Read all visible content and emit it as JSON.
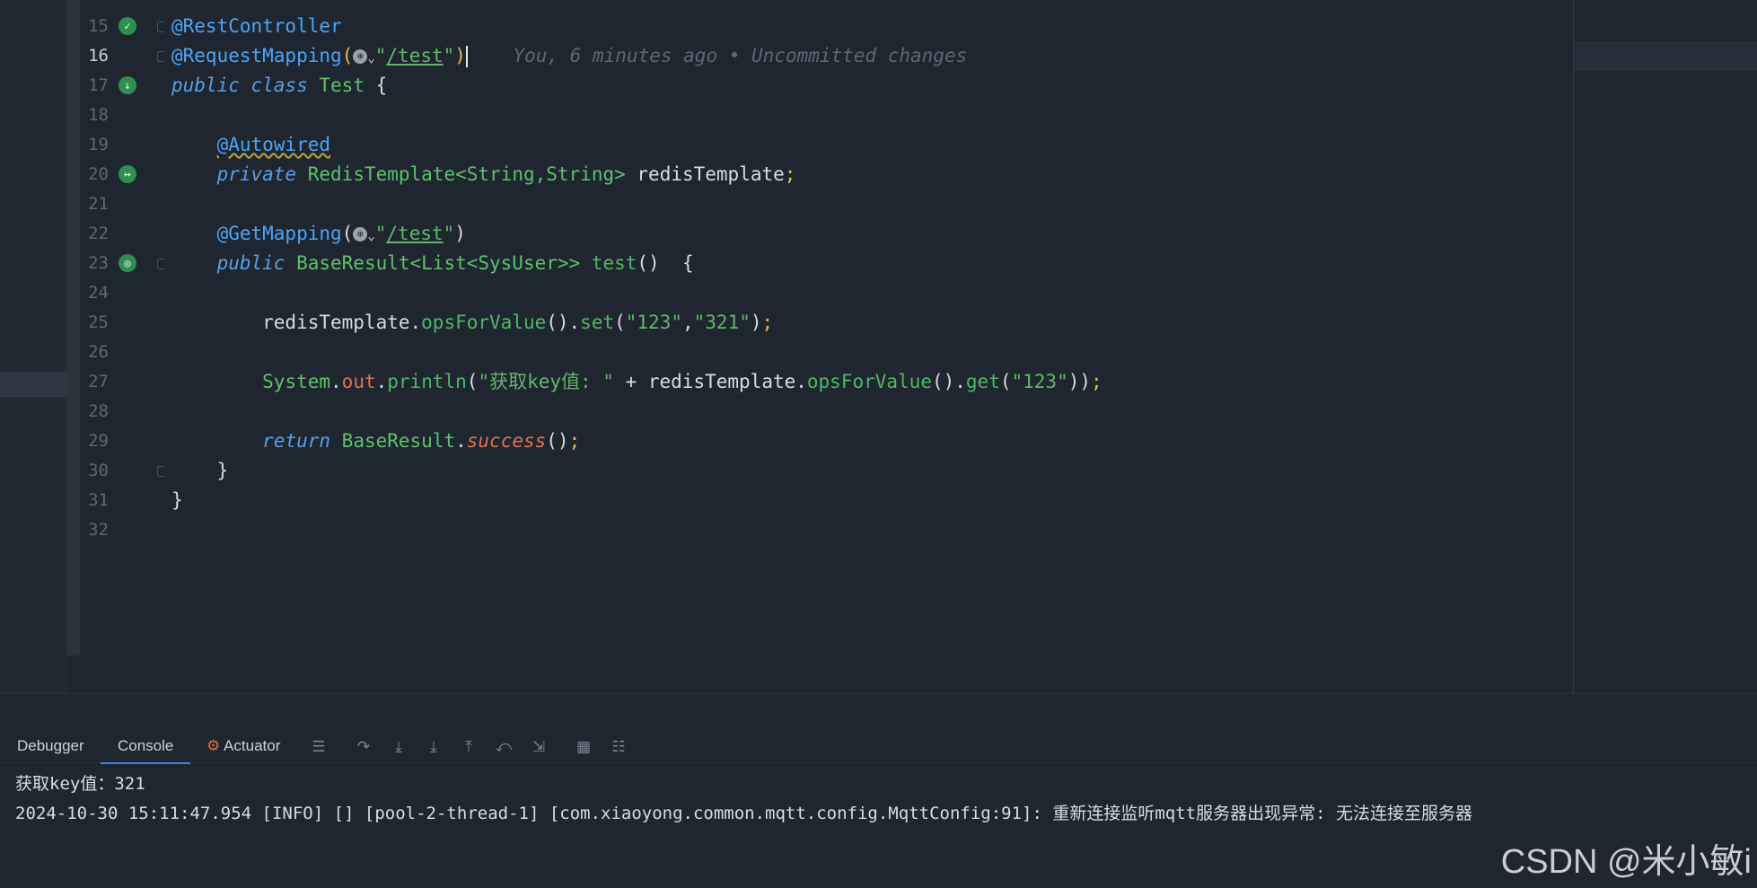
{
  "editor": {
    "lines": [
      {
        "num": "15",
        "tokens": [
          {
            "c": "ann",
            "t": "@RestController"
          }
        ]
      },
      {
        "num": "16",
        "current": true,
        "tokens": [
          {
            "c": "ann",
            "t": "@RequestMapping"
          },
          {
            "c": "sep",
            "t": "("
          },
          {
            "c": "str",
            "t": "\""
          },
          {
            "c": "link",
            "t": "/test"
          },
          {
            "c": "str",
            "t": "\""
          },
          {
            "c": "sep",
            "t": ")"
          }
        ],
        "hint": "You, 6 minutes ago • Uncommitted changes"
      },
      {
        "num": "17",
        "tokens": [
          {
            "c": "kw",
            "t": "public"
          },
          {
            "c": "plain",
            "t": " "
          },
          {
            "c": "kw",
            "t": "class"
          },
          {
            "c": "plain",
            "t": " "
          },
          {
            "c": "type",
            "t": "Test"
          },
          {
            "c": "plain",
            "t": " {"
          }
        ]
      },
      {
        "num": "18",
        "tokens": []
      },
      {
        "num": "19",
        "tokens": [
          {
            "c": "plain",
            "t": "    "
          },
          {
            "c": "ann wavy",
            "t": "@Autowired"
          }
        ]
      },
      {
        "num": "20",
        "tokens": [
          {
            "c": "plain",
            "t": "    "
          },
          {
            "c": "kw",
            "t": "private"
          },
          {
            "c": "plain",
            "t": " "
          },
          {
            "c": "type",
            "t": "RedisTemplate<String,String>"
          },
          {
            "c": "plain",
            "t": " redisTemplate"
          },
          {
            "c": "sep",
            "t": ";"
          }
        ]
      },
      {
        "num": "21",
        "tokens": []
      },
      {
        "num": "22",
        "tokens": [
          {
            "c": "plain",
            "t": "    "
          },
          {
            "c": "ann",
            "t": "@GetMapping"
          },
          {
            "c": "punct",
            "t": "("
          },
          {
            "c": "str",
            "t": "\""
          },
          {
            "c": "link",
            "t": "/test"
          },
          {
            "c": "str",
            "t": "\""
          },
          {
            "c": "punct",
            "t": ")"
          }
        ]
      },
      {
        "num": "23",
        "tokens": [
          {
            "c": "plain",
            "t": "    "
          },
          {
            "c": "kw",
            "t": "public"
          },
          {
            "c": "plain",
            "t": " "
          },
          {
            "c": "type",
            "t": "BaseResult<List<SysUser>>"
          },
          {
            "c": "plain",
            "t": " "
          },
          {
            "c": "method",
            "t": "test"
          },
          {
            "c": "punct",
            "t": "()  {"
          }
        ]
      },
      {
        "num": "24",
        "tokens": []
      },
      {
        "num": "25",
        "tokens": [
          {
            "c": "plain",
            "t": "        redisTemplate."
          },
          {
            "c": "method",
            "t": "opsForValue"
          },
          {
            "c": "punct",
            "t": "()."
          },
          {
            "c": "method",
            "t": "set"
          },
          {
            "c": "punct",
            "t": "("
          },
          {
            "c": "str",
            "t": "\"123\""
          },
          {
            "c": "punct",
            "t": ","
          },
          {
            "c": "str",
            "t": "\"321\""
          },
          {
            "c": "punct",
            "t": ")"
          },
          {
            "c": "sep",
            "t": ";"
          }
        ]
      },
      {
        "num": "26",
        "tokens": []
      },
      {
        "num": "27",
        "tokens": [
          {
            "c": "plain",
            "t": "        "
          },
          {
            "c": "type",
            "t": "System"
          },
          {
            "c": "punct",
            "t": "."
          },
          {
            "c": "field",
            "t": "out"
          },
          {
            "c": "punct",
            "t": "."
          },
          {
            "c": "method",
            "t": "println"
          },
          {
            "c": "punct",
            "t": "("
          },
          {
            "c": "str",
            "t": "\"获取key值: \""
          },
          {
            "c": "punct",
            "t": " + redisTemplate."
          },
          {
            "c": "method",
            "t": "opsForValue"
          },
          {
            "c": "punct",
            "t": "()."
          },
          {
            "c": "method",
            "t": "get"
          },
          {
            "c": "punct",
            "t": "("
          },
          {
            "c": "str",
            "t": "\"123\""
          },
          {
            "c": "punct",
            "t": "))"
          },
          {
            "c": "sep",
            "t": ";"
          }
        ]
      },
      {
        "num": "28",
        "tokens": []
      },
      {
        "num": "29",
        "tokens": [
          {
            "c": "plain",
            "t": "        "
          },
          {
            "c": "kw",
            "t": "return"
          },
          {
            "c": "plain",
            "t": " "
          },
          {
            "c": "type",
            "t": "BaseResult"
          },
          {
            "c": "punct",
            "t": "."
          },
          {
            "c": "static",
            "t": "success"
          },
          {
            "c": "punct",
            "t": "()"
          },
          {
            "c": "sep",
            "t": ";"
          }
        ]
      },
      {
        "num": "30",
        "tokens": [
          {
            "c": "plain",
            "t": "    }"
          }
        ]
      },
      {
        "num": "31",
        "tokens": [
          {
            "c": "plain",
            "t": "}"
          }
        ]
      },
      {
        "num": "32",
        "tokens": []
      }
    ]
  },
  "panel": {
    "tabs": {
      "debugger": "Debugger",
      "console": "Console",
      "actuator": "Actuator"
    },
    "console": [
      "获取key值：321",
      "2024-10-30 15:11:47.954 [INFO] [] [pool-2-thread-1] [com.xiaoyong.common.mqtt.config.MqttConfig:91]: 重新连接监听mqtt服务器出现异常: 无法连接至服务器"
    ]
  },
  "watermark": "CSDN @米小敏i"
}
